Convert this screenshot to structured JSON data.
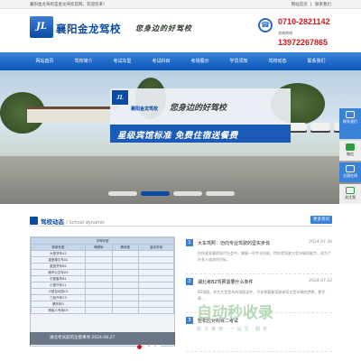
{
  "topbar": {
    "welcome": "襄阳金龙驾校是金龙驾校官网，欢迎您来！",
    "links": "网站首页 | 联系我们"
  },
  "header": {
    "logo_mark": "JL",
    "site_name": "襄阳金龙驾校",
    "slogan": "您身边的好驾校",
    "phones": [
      "0710-2821142",
      "13972267865"
    ],
    "phone_label": "咨询热线",
    "phone_icon": "☎"
  },
  "nav": [
    "网站首页",
    "驾校简介",
    "考试车型",
    "考试科目",
    "考场展示",
    "学员须知",
    "驾校动态",
    "联系我们"
  ],
  "banner": {
    "logo_mark": "JL",
    "name": "襄阳金龙驾校",
    "slogan": "您身边的好驾校",
    "strip": "星级宾馆标准  免费住宿送餐费"
  },
  "side": [
    "联系我们",
    "微信",
    "全国在线",
    "关注我"
  ],
  "section": {
    "title": "驾校动态",
    "subtitle": "/ School dynamic",
    "more": "更多资讯"
  },
  "table_caption": "湖北考试前的注意事项 2024.08.27",
  "table": [
    [
      "学驾车型",
      "",
      "",
      ""
    ],
    [
      "驾驶车型",
      "驾照场",
      "教练费",
      "量定时间"
    ],
    [
      "大型货车A2",
      "",
      "",
      ""
    ],
    [
      "重型牵引车A1",
      "",
      "",
      ""
    ],
    [
      "重型货车B2",
      "",
      "",
      ""
    ],
    [
      "城市公交车A3",
      "",
      "",
      ""
    ],
    [
      "中型客车B1",
      "",
      "",
      ""
    ],
    [
      "小型汽车C1",
      "",
      "",
      ""
    ],
    [
      "小型自动挡C2",
      "",
      "",
      ""
    ],
    [
      "三轮汽车C3",
      "",
      "",
      ""
    ],
    [
      "摩托车D",
      "",
      "",
      ""
    ],
    [
      "残疾人专用C5",
      "",
      "",
      ""
    ]
  ],
  "news": [
    {
      "num": "1",
      "title": "大车驾照：迈向专业驾驶的坚实步伐",
      "date": "2024.07.30",
      "desc": "在快速发展的现代社会中，掌握一项专业技能，特别是驾驶大型车辆的能力，成为了许多人追求的目标。"
    },
    {
      "num": "2",
      "title": "湖北考B2驾照需要什么条件",
      "date": "2024.07.22",
      "desc": "B2驾照，作为大型货车的驾照证件，不仅承载着驾驶者驾大型车辆的梦想，更代表…"
    },
    {
      "num": "3",
      "title": "轻松应对科目二考试",
      "date": "",
      "desc": ""
    }
  ],
  "watermark": {
    "title": "自动秒收录",
    "sub": "软文推荐·一站式·服务"
  }
}
